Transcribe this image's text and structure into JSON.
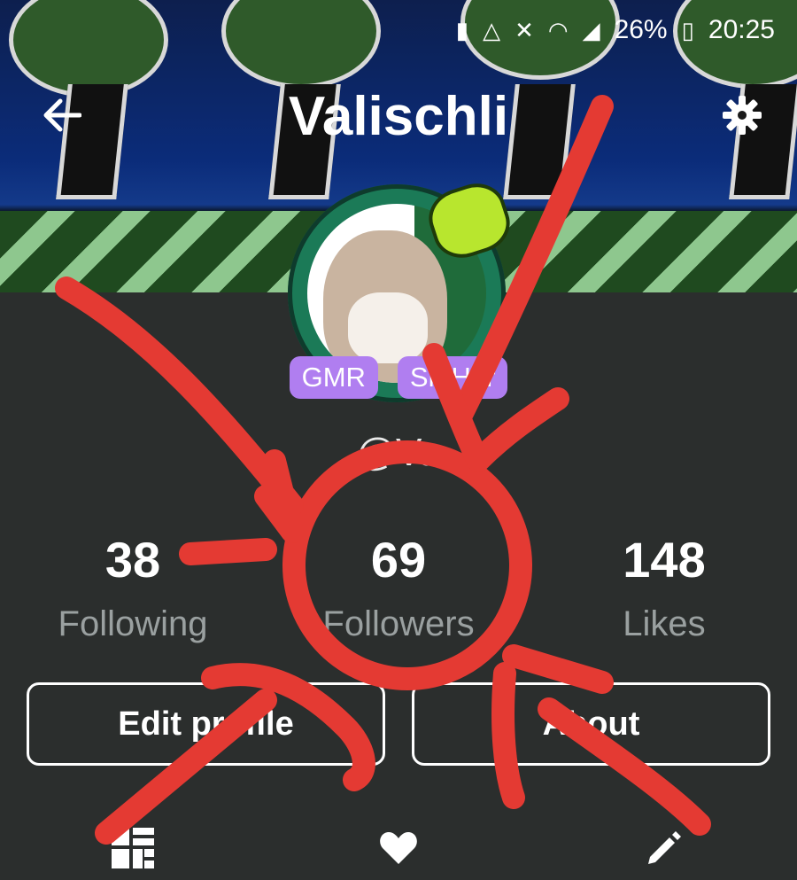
{
  "status_bar": {
    "battery_percent": "26%",
    "time": "20:25",
    "icons": [
      "battery-saver-icon",
      "data-saver-icon",
      "mute-icon",
      "wifi-icon",
      "signal-icon",
      "battery-icon"
    ]
  },
  "header": {
    "title": "Valischli",
    "back_icon": "arrow-left-icon",
    "settings_icon": "gear-icon"
  },
  "profile": {
    "handle": "@Va",
    "badges": [
      "GMR",
      "Sh Her"
    ]
  },
  "stats": [
    {
      "value": "38",
      "label": "Following"
    },
    {
      "value": "69",
      "label": "Followers"
    },
    {
      "value": "148",
      "label": "Likes"
    }
  ],
  "actions": {
    "edit_label": "Edit profile",
    "about_label": "About"
  },
  "tabs": [
    {
      "icon": "grid-icon"
    },
    {
      "icon": "heart-icon"
    },
    {
      "icon": "pencil-icon"
    }
  ],
  "colors": {
    "background": "#2b2e2d",
    "badge": "#b07ef0",
    "scribble": "#e43a33",
    "label_gray": "#9aa0a0"
  }
}
